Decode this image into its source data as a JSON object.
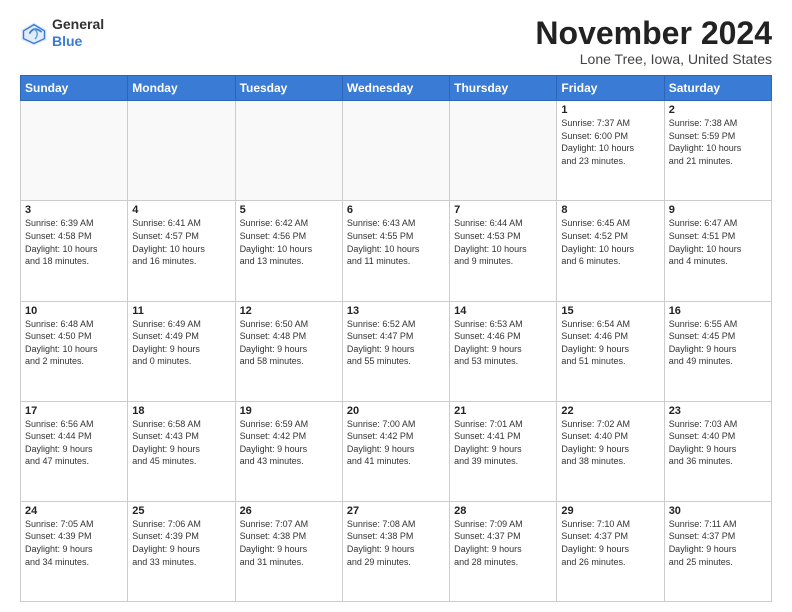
{
  "header": {
    "logo_general": "General",
    "logo_blue": "Blue",
    "month_title": "November 2024",
    "location": "Lone Tree, Iowa, United States"
  },
  "days_of_week": [
    "Sunday",
    "Monday",
    "Tuesday",
    "Wednesday",
    "Thursday",
    "Friday",
    "Saturday"
  ],
  "weeks": [
    [
      {
        "day": "",
        "info": ""
      },
      {
        "day": "",
        "info": ""
      },
      {
        "day": "",
        "info": ""
      },
      {
        "day": "",
        "info": ""
      },
      {
        "day": "",
        "info": ""
      },
      {
        "day": "1",
        "info": "Sunrise: 7:37 AM\nSunset: 6:00 PM\nDaylight: 10 hours\nand 23 minutes."
      },
      {
        "day": "2",
        "info": "Sunrise: 7:38 AM\nSunset: 5:59 PM\nDaylight: 10 hours\nand 21 minutes."
      }
    ],
    [
      {
        "day": "3",
        "info": "Sunrise: 6:39 AM\nSunset: 4:58 PM\nDaylight: 10 hours\nand 18 minutes."
      },
      {
        "day": "4",
        "info": "Sunrise: 6:41 AM\nSunset: 4:57 PM\nDaylight: 10 hours\nand 16 minutes."
      },
      {
        "day": "5",
        "info": "Sunrise: 6:42 AM\nSunset: 4:56 PM\nDaylight: 10 hours\nand 13 minutes."
      },
      {
        "day": "6",
        "info": "Sunrise: 6:43 AM\nSunset: 4:55 PM\nDaylight: 10 hours\nand 11 minutes."
      },
      {
        "day": "7",
        "info": "Sunrise: 6:44 AM\nSunset: 4:53 PM\nDaylight: 10 hours\nand 9 minutes."
      },
      {
        "day": "8",
        "info": "Sunrise: 6:45 AM\nSunset: 4:52 PM\nDaylight: 10 hours\nand 6 minutes."
      },
      {
        "day": "9",
        "info": "Sunrise: 6:47 AM\nSunset: 4:51 PM\nDaylight: 10 hours\nand 4 minutes."
      }
    ],
    [
      {
        "day": "10",
        "info": "Sunrise: 6:48 AM\nSunset: 4:50 PM\nDaylight: 10 hours\nand 2 minutes."
      },
      {
        "day": "11",
        "info": "Sunrise: 6:49 AM\nSunset: 4:49 PM\nDaylight: 9 hours\nand 0 minutes."
      },
      {
        "day": "12",
        "info": "Sunrise: 6:50 AM\nSunset: 4:48 PM\nDaylight: 9 hours\nand 58 minutes."
      },
      {
        "day": "13",
        "info": "Sunrise: 6:52 AM\nSunset: 4:47 PM\nDaylight: 9 hours\nand 55 minutes."
      },
      {
        "day": "14",
        "info": "Sunrise: 6:53 AM\nSunset: 4:46 PM\nDaylight: 9 hours\nand 53 minutes."
      },
      {
        "day": "15",
        "info": "Sunrise: 6:54 AM\nSunset: 4:46 PM\nDaylight: 9 hours\nand 51 minutes."
      },
      {
        "day": "16",
        "info": "Sunrise: 6:55 AM\nSunset: 4:45 PM\nDaylight: 9 hours\nand 49 minutes."
      }
    ],
    [
      {
        "day": "17",
        "info": "Sunrise: 6:56 AM\nSunset: 4:44 PM\nDaylight: 9 hours\nand 47 minutes."
      },
      {
        "day": "18",
        "info": "Sunrise: 6:58 AM\nSunset: 4:43 PM\nDaylight: 9 hours\nand 45 minutes."
      },
      {
        "day": "19",
        "info": "Sunrise: 6:59 AM\nSunset: 4:42 PM\nDaylight: 9 hours\nand 43 minutes."
      },
      {
        "day": "20",
        "info": "Sunrise: 7:00 AM\nSunset: 4:42 PM\nDaylight: 9 hours\nand 41 minutes."
      },
      {
        "day": "21",
        "info": "Sunrise: 7:01 AM\nSunset: 4:41 PM\nDaylight: 9 hours\nand 39 minutes."
      },
      {
        "day": "22",
        "info": "Sunrise: 7:02 AM\nSunset: 4:40 PM\nDaylight: 9 hours\nand 38 minutes."
      },
      {
        "day": "23",
        "info": "Sunrise: 7:03 AM\nSunset: 4:40 PM\nDaylight: 9 hours\nand 36 minutes."
      }
    ],
    [
      {
        "day": "24",
        "info": "Sunrise: 7:05 AM\nSunset: 4:39 PM\nDaylight: 9 hours\nand 34 minutes."
      },
      {
        "day": "25",
        "info": "Sunrise: 7:06 AM\nSunset: 4:39 PM\nDaylight: 9 hours\nand 33 minutes."
      },
      {
        "day": "26",
        "info": "Sunrise: 7:07 AM\nSunset: 4:38 PM\nDaylight: 9 hours\nand 31 minutes."
      },
      {
        "day": "27",
        "info": "Sunrise: 7:08 AM\nSunset: 4:38 PM\nDaylight: 9 hours\nand 29 minutes."
      },
      {
        "day": "28",
        "info": "Sunrise: 7:09 AM\nSunset: 4:37 PM\nDaylight: 9 hours\nand 28 minutes."
      },
      {
        "day": "29",
        "info": "Sunrise: 7:10 AM\nSunset: 4:37 PM\nDaylight: 9 hours\nand 26 minutes."
      },
      {
        "day": "30",
        "info": "Sunrise: 7:11 AM\nSunset: 4:37 PM\nDaylight: 9 hours\nand 25 minutes."
      }
    ]
  ]
}
